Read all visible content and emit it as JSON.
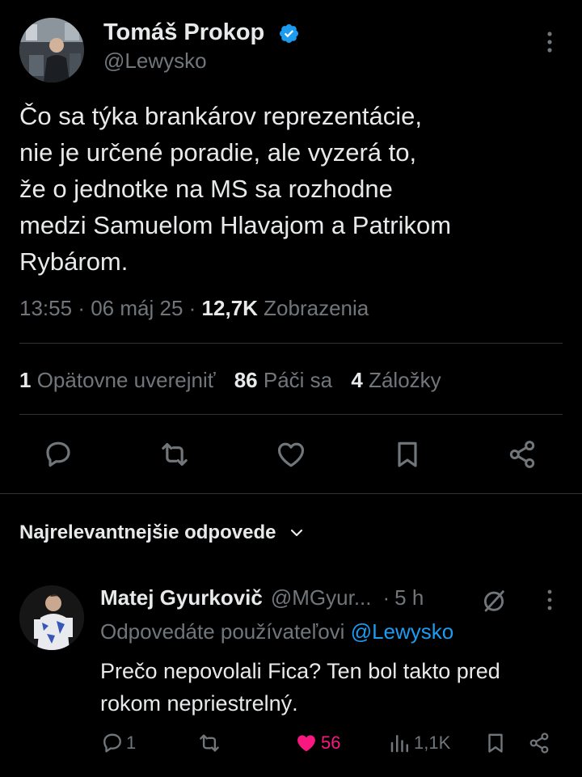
{
  "tweet": {
    "author_name": "Tomáš Prokop",
    "author_handle": "@Lewysko",
    "text_lines": [
      "Čo sa týka brankárov reprezentácie,",
      "nie je určené poradie, ale vyzerá to,",
      "že o jednotke na MS sa rozhodne",
      "medzi Samuelom Hlavajom a Patrikom",
      "Rybárom."
    ],
    "time": "13:55",
    "date": "06 máj 25",
    "views_count": "12,7K",
    "views_label": "Zobrazenia",
    "reposts_count": "1",
    "reposts_label": "Opätovne uverejniť",
    "likes_count": "86",
    "likes_label": "Páči sa",
    "bookmarks_count": "4",
    "bookmarks_label": "Záložky",
    "sep": "·"
  },
  "replies_header": {
    "label": "Najrelevantnejšie odpovede"
  },
  "reply": {
    "author_name": "Matej Gyurkovič",
    "author_handle": "@MGyur...",
    "time": "5 h",
    "replying_prefix": "Odpovedáte používateľovi",
    "replying_handle": "@Lewysko",
    "text_lines": [
      "Prečo nepovolali Fica? Ten bol takto pred",
      "rokom nepriestrelný."
    ],
    "reply_count": "1",
    "like_count": "56",
    "views_count": "1,1K",
    "sep": "·"
  },
  "colors": {
    "background": "#000000",
    "text": "#e7e9ea",
    "muted": "#71767b",
    "accent": "#1d9bf0",
    "like": "#f91880",
    "divider": "#2f3336"
  },
  "icons": {
    "verified": "verified-badge-icon",
    "more": "more-vertical-icon",
    "reply": "comment-icon",
    "repost": "repost-icon",
    "like": "heart-icon",
    "bookmark": "bookmark-icon",
    "share": "share-icon",
    "chevron": "chevron-down-icon",
    "views": "views-bar-icon",
    "grok": "grok-icon"
  }
}
